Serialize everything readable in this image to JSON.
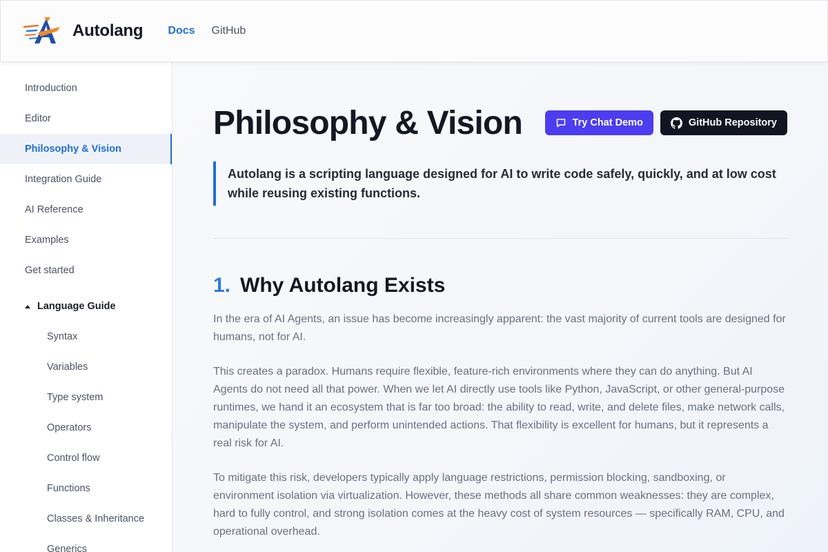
{
  "header": {
    "brand": "Autolang",
    "nav": [
      {
        "label": "Docs",
        "active": true
      },
      {
        "label": "GitHub",
        "active": false
      }
    ]
  },
  "sidebar": {
    "items": [
      {
        "label": "Introduction"
      },
      {
        "label": "Editor"
      },
      {
        "label": "Philosophy & Vision",
        "active": true
      },
      {
        "label": "Integration Guide"
      },
      {
        "label": "AI Reference"
      },
      {
        "label": "Examples"
      },
      {
        "label": "Get started"
      }
    ],
    "group": {
      "label": "Language Guide",
      "items": [
        "Syntax",
        "Variables",
        "Type system",
        "Operators",
        "Control flow",
        "Functions",
        "Classes & Inheritance",
        "Generics"
      ]
    }
  },
  "main": {
    "title": "Philosophy & Vision",
    "buttons": {
      "chat": "Try Chat Demo",
      "github": "GitHub Repository"
    },
    "lead": "Autolang is a scripting language designed for AI to write code safely, quickly, and at low cost while reusing existing functions.",
    "section": {
      "number": "1.",
      "title": "Why Autolang Exists"
    },
    "paragraphs": [
      "In the era of AI Agents, an issue has become increasingly apparent: the vast majority of current tools are designed for humans, not for AI.",
      "This creates a paradox. Humans require flexible, feature-rich environments where they can do anything. But AI Agents do not need all that power. When we let AI directly use tools like Python, JavaScript, or other general-purpose runtimes, we hand it an ecosystem that is far too broad: the ability to read, write, and delete files, make network calls, manipulate the system, and perform unintended actions. That flexibility is excellent for humans, but it represents a real risk for AI.",
      "To mitigate this risk, developers typically apply language restrictions, permission blocking, sandboxing, or environment isolation via virtualization. However, these methods all share common weaknesses: they are complex, hard to fully control, and strong isolation comes at the heavy cost of system resources — specifically RAM, CPU, and operational overhead."
    ]
  },
  "colors": {
    "accent": "#1f6fd6",
    "chat_button": "#4c3df0",
    "github_button": "#111522"
  },
  "icons": [
    "autolang-logo",
    "chat-icon",
    "github-icon",
    "caret-up-icon"
  ]
}
